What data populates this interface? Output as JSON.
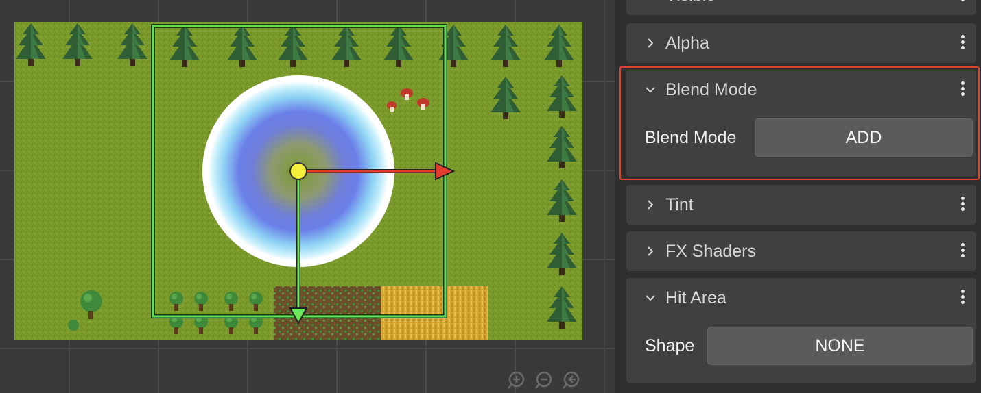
{
  "inspector": {
    "sections": [
      {
        "title": "Visible",
        "expanded": false,
        "icon": "chevron-right-icon"
      },
      {
        "title": "Alpha",
        "expanded": false,
        "icon": "chevron-right-icon"
      },
      {
        "title": "Blend Mode",
        "expanded": true,
        "icon": "chevron-down-icon",
        "property_label": "Blend Mode",
        "property_value": "ADD",
        "highlighted": true
      },
      {
        "title": "Tint",
        "expanded": false,
        "icon": "chevron-right-icon"
      },
      {
        "title": "FX Shaders",
        "expanded": false,
        "icon": "chevron-right-icon"
      },
      {
        "title": "Hit Area",
        "expanded": true,
        "icon": "chevron-down-icon",
        "property_label": "Shape",
        "property_value": "NONE"
      }
    ]
  },
  "viewport": {
    "gizmo": {
      "x_axis_color": "#e53b2c",
      "y_axis_color": "#6ee85a",
      "origin_color": "#f4ef3a"
    },
    "selection_color": "#5fe05a",
    "zoom_controls": [
      "zoom-in-icon",
      "zoom-out-icon",
      "zoom-reset-icon"
    ]
  },
  "colors": {
    "highlight": "#e0442c",
    "panel": "#404040"
  }
}
